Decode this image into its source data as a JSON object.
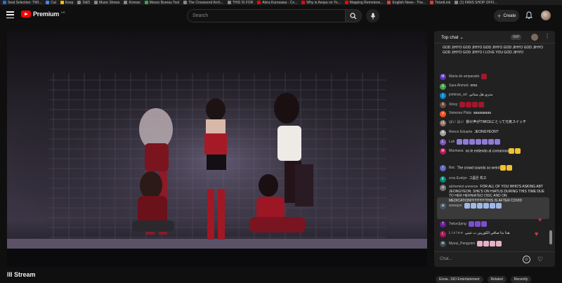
{
  "bookmarks": [
    {
      "label": "Seat Selection: TWI...",
      "color": "#1a73e8"
    },
    {
      "label": "Cal",
      "color": "#4285f4"
    },
    {
      "label": "Keep",
      "color": "#fbbc04"
    },
    {
      "label": "D&D",
      "color": "#888888"
    },
    {
      "label": "Music Shows",
      "color": "#888888"
    },
    {
      "label": "Korean",
      "color": "#888888"
    },
    {
      "label": "Moxxo Bureau Tool",
      "color": "#34a853"
    },
    {
      "label": "The Crossword Arch...",
      "color": "#888888"
    },
    {
      "label": "THIS IS FOR",
      "color": "#888888"
    },
    {
      "label": "Akira Kurosawa - Co...",
      "color": "#ff0000"
    },
    {
      "label": "Why is Aespa on Yo...",
      "color": "#ff0000"
    },
    {
      "label": "Mapping Remotene...",
      "color": "#ff0000"
    },
    {
      "label": "English News - The...",
      "color": "#e53935"
    },
    {
      "label": "TicketLink",
      "color": "#e53935"
    },
    {
      "label": "(1) FANS SHOP OFFI...",
      "color": "#888888"
    }
  ],
  "header": {
    "logo_text": "Premium",
    "logo_sup": "KR",
    "search_placeholder": "Search",
    "create_label": "Create"
  },
  "video": {
    "title": "III Stream"
  },
  "chips": [
    "Enow...SIO Entertainment",
    "Related",
    "Recently"
  ],
  "chat": {
    "header_label": "Top chat",
    "badge": "0XP",
    "input_placeholder": "Chat...",
    "messages": [
      {
        "author": "",
        "text": "GOD JIHYO GOD JIHYO GOD JIHYO GOD JIHYO GOD JIHYO GOD JIHYO GOD JIHYO I LOVE YOU GOD JIHYO",
        "avatar_color": "#00000000",
        "avatar_letter": ""
      },
      {
        "author": "Maria do amparado",
        "text": "",
        "avatar_color": "#5e35b1",
        "avatar_letter": "M"
      },
      {
        "author": "Sara Ahmed",
        "text": "omo",
        "avatar_color": "#43a047",
        "avatar_letter": "S"
      },
      {
        "author": "jominax_art",
        "text": "مدري هل سناني",
        "avatar_color": "#0288d1",
        "avatar_letter": "j"
      },
      {
        "author": "Xinxy",
        "text": "",
        "avatar_color": "#6d4c41",
        "avatar_letter": "X"
      },
      {
        "author": "Vanessa Plata",
        "text": "aaaaaaaaa",
        "avatar_color": "#f4511e",
        "avatar_letter": "V"
      },
      {
        "author": "はい はい",
        "text": "掛け声がTWICEにとって元気スイッチ",
        "avatar_color": "#8d6e63",
        "avatar_letter": "は"
      },
      {
        "author": "Rence Eduarte",
        "text": "JEONGYEON?",
        "avatar_color": "#9e9e9e",
        "avatar_letter": "R"
      },
      {
        "author": "Luh",
        "text": "",
        "avatar_color": "#7e57c2",
        "avatar_letter": "L"
      },
      {
        "author": "Marinasa",
        "text": "no le entiendo al coreanooo",
        "avatar_color": "#c2185b",
        "avatar_letter": "M"
      },
      {
        "author": "lilac",
        "text": "The crowd sounds so weird",
        "avatar_color": "#5c6bc0",
        "avatar_letter": "l"
      },
      {
        "author": "ᴏᴛɪs Evelyn",
        "text": "그룹은 최고",
        "avatar_color": "#00897b",
        "avatar_letter": "E"
      },
      {
        "author": "alchemist universe",
        "text": "FOR ALL OF YOU WHO'S ASKING ABT JEONGYEON: SHE'S ON HIATUS DURING THIS TIME DUE TO HER HERNIATED DISC AND ON MEDICATION!!!!!!!!!!!!!!!THIS IS AFTER COVID",
        "avatar_color": "#757575",
        "avatar_letter": "a"
      },
      {
        "author": "wonejoo",
        "text": "",
        "avatar_color": "#455a64",
        "avatar_letter": "w"
      },
      {
        "author": "TwiceJjang",
        "text": "",
        "avatar_color": "#6a1b9a",
        "avatar_letter": "T"
      },
      {
        "author": "L i z l e e",
        "text": "هذا بذا صافي الكوريين ب عيني",
        "avatar_color": "#ad1457",
        "avatar_letter": "L"
      },
      {
        "author": "Myoui_Penguinn",
        "text": "",
        "avatar_color": "#37474f",
        "avatar_letter": "M"
      }
    ]
  }
}
